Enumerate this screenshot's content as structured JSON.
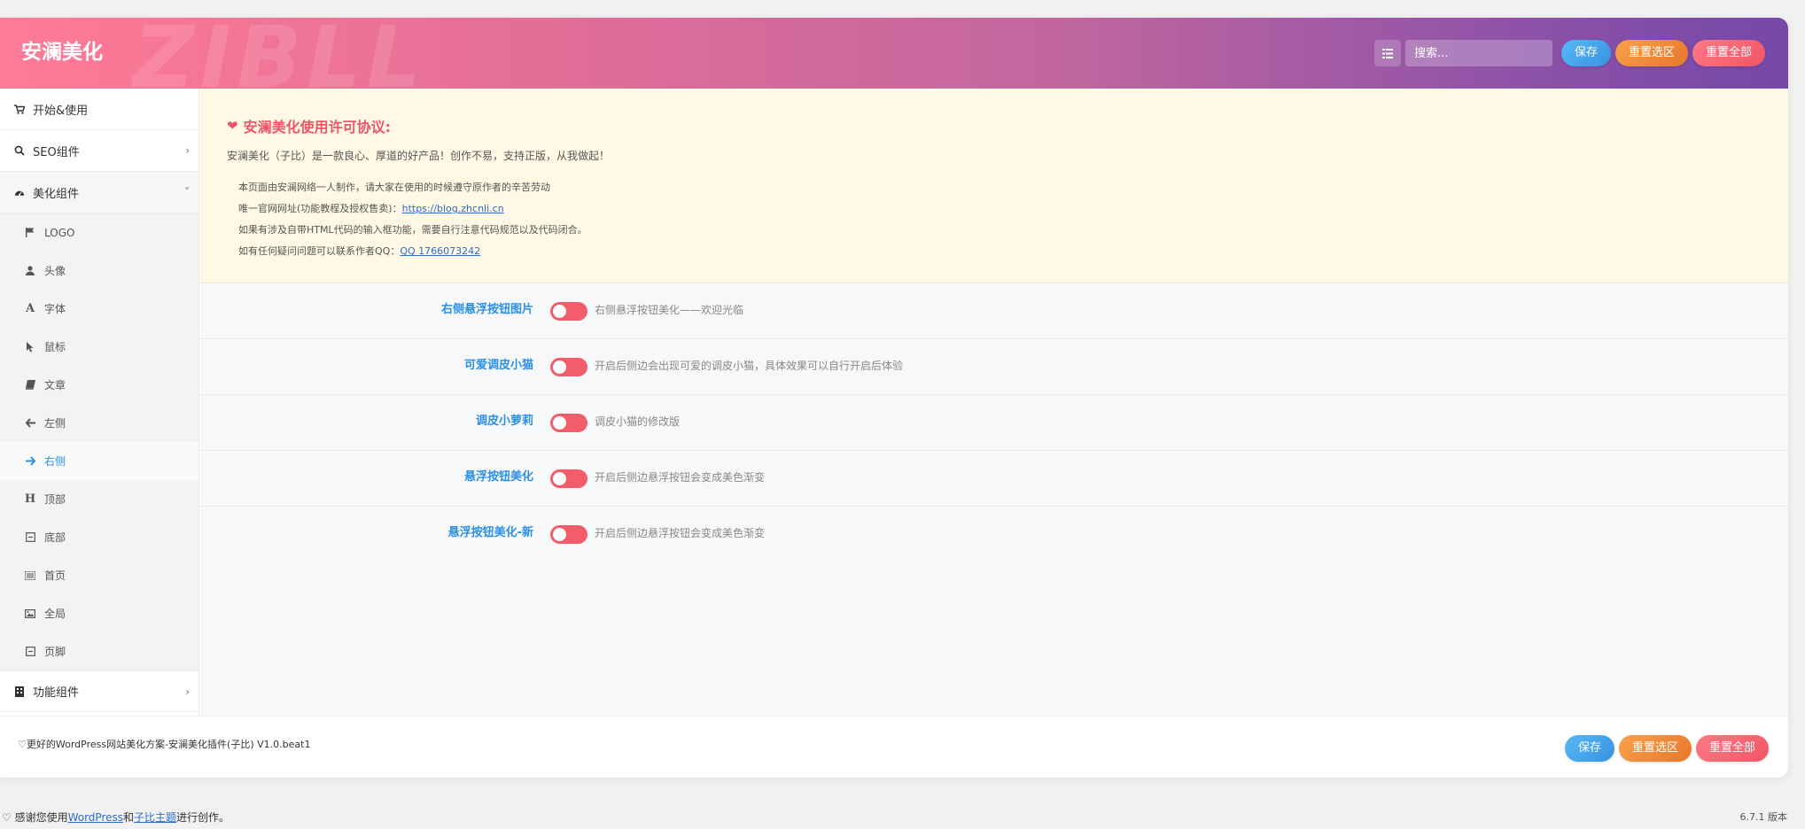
{
  "header": {
    "brand": "安澜美化",
    "watermark": "ZIBLL",
    "search_placeholder": "搜索...",
    "save_label": "保存",
    "reset_section_label": "重置选区",
    "reset_all_label": "重置全部"
  },
  "sidebar": {
    "top_items": [
      {
        "label": "开始&使用",
        "icon": "cart-icon"
      },
      {
        "label": "SEO组件",
        "icon": "search-icon"
      },
      {
        "label": "美化组件",
        "icon": "dashboard-icon"
      }
    ],
    "sub_items": [
      {
        "label": "LOGO",
        "icon": "flag-icon"
      },
      {
        "label": "头像",
        "icon": "user-icon"
      },
      {
        "label": "字体",
        "icon": "font-icon"
      },
      {
        "label": "鼠标",
        "icon": "cursor-icon"
      },
      {
        "label": "文章",
        "icon": "book-icon"
      },
      {
        "label": "左侧",
        "icon": "arrow-left-icon"
      },
      {
        "label": "右侧",
        "icon": "arrow-right-icon"
      },
      {
        "label": "顶部",
        "icon": "header-icon"
      },
      {
        "label": "底部",
        "icon": "square-minus-icon"
      },
      {
        "label": "首页",
        "icon": "list-icon"
      },
      {
        "label": "全局",
        "icon": "image-icon"
      },
      {
        "label": "页脚",
        "icon": "square-minus-icon"
      }
    ],
    "bottom_item": {
      "label": "功能组件",
      "icon": "building-icon"
    }
  },
  "notice": {
    "title": "安澜美化使用许可协议:",
    "subtitle": "安澜美化（子比）是一款良心、厚道的好产品！创作不易，支持正版，从我做起！",
    "line1": "本页面由安澜网络一人制作，请大家在使用的时候遵守原作者的辛苦劳动",
    "line2_prefix": "唯一官网网址(功能教程及授权售卖)：",
    "line2_link": "https://blog.zhcnli.cn",
    "line3": "如果有涉及自带HTML代码的输入框功能，需要自行注意代码规范以及代码闭合。",
    "line4_prefix": "如有任何疑问问题可以联系作者QQ：",
    "line4_link": "QQ 1766073242"
  },
  "options": [
    {
      "label": "右侧悬浮按钮图片",
      "desc": "右侧悬浮按钮美化——欢迎光临",
      "enabled": false
    },
    {
      "label": "可爱调皮小猫",
      "desc": "开启后侧边会出现可爱的调皮小猫，具体效果可以自行开启后体验",
      "enabled": false
    },
    {
      "label": "调皮小萝莉",
      "desc": "调皮小猫的修改版",
      "enabled": false
    },
    {
      "label": "悬浮按钮美化",
      "desc": "开启后侧边悬浮按钮会变成美色渐变",
      "enabled": false
    },
    {
      "label": "悬浮按钮美化-新",
      "desc": "开启后侧边悬浮按钮会变成美色渐变",
      "enabled": false
    }
  ],
  "footer": {
    "text": "♡更好的WordPress网站美化方案-安澜美化插件(子比) V1.0.beat1",
    "save_label": "保存",
    "reset_section_label": "重置选区",
    "reset_all_label": "重置全部"
  },
  "page_footer": {
    "prefix": "♡ 感谢您使用",
    "wp_link": "WordPress",
    "middle": "和",
    "theme_link": "子比主题",
    "suffix": "进行创作。",
    "version": "6.7.1 版本"
  },
  "colors": {
    "accent_blue": "#2b8fe6",
    "toggle_off": "#f25d6c",
    "notice_bg": "#fff8e4",
    "title_red": "#f05566"
  }
}
